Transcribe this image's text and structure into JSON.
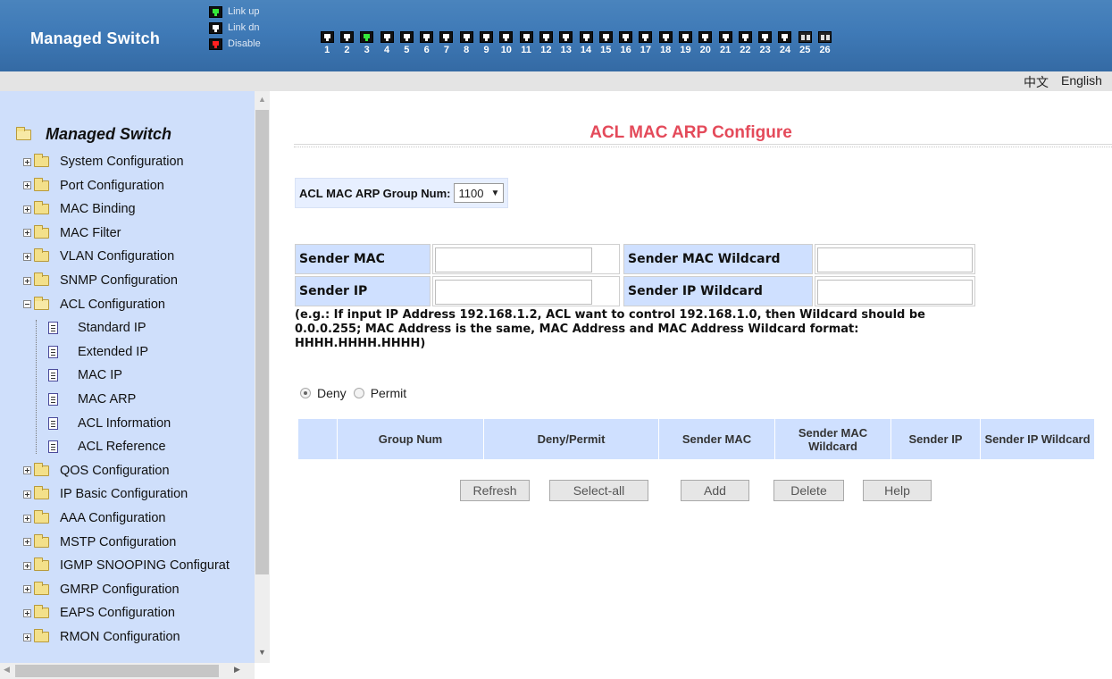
{
  "header": {
    "brand": "Managed Switch",
    "legend": [
      {
        "label": "Link up",
        "state": "green"
      },
      {
        "label": "Link dn",
        "state": "white"
      },
      {
        "label": "Disable",
        "state": "red"
      }
    ],
    "ports": [
      {
        "num": "1",
        "state": "down"
      },
      {
        "num": "2",
        "state": "down"
      },
      {
        "num": "3",
        "state": "up"
      },
      {
        "num": "4",
        "state": "down"
      },
      {
        "num": "5",
        "state": "down"
      },
      {
        "num": "6",
        "state": "down"
      },
      {
        "num": "7",
        "state": "down"
      },
      {
        "num": "8",
        "state": "down"
      },
      {
        "num": "9",
        "state": "down"
      },
      {
        "num": "10",
        "state": "down"
      },
      {
        "num": "11",
        "state": "down"
      },
      {
        "num": "12",
        "state": "down"
      },
      {
        "num": "13",
        "state": "down"
      },
      {
        "num": "14",
        "state": "down"
      },
      {
        "num": "15",
        "state": "down"
      },
      {
        "num": "16",
        "state": "down"
      },
      {
        "num": "17",
        "state": "down"
      },
      {
        "num": "18",
        "state": "down"
      },
      {
        "num": "19",
        "state": "down"
      },
      {
        "num": "20",
        "state": "down"
      },
      {
        "num": "21",
        "state": "down"
      },
      {
        "num": "22",
        "state": "down"
      },
      {
        "num": "23",
        "state": "down"
      },
      {
        "num": "24",
        "state": "down"
      },
      {
        "num": "25",
        "state": "fiber"
      },
      {
        "num": "26",
        "state": "fiber"
      }
    ]
  },
  "lang": {
    "chinese": "中文",
    "english": "English"
  },
  "sidebar": {
    "root": "Managed Switch",
    "items": [
      {
        "label": "System Configuration"
      },
      {
        "label": "Port Configuration"
      },
      {
        "label": "MAC Binding"
      },
      {
        "label": "MAC Filter"
      },
      {
        "label": "VLAN Configuration"
      },
      {
        "label": "SNMP Configuration"
      },
      {
        "label": "ACL Configuration"
      },
      {
        "label": "QOS Configuration"
      },
      {
        "label": "IP Basic Configuration"
      },
      {
        "label": "AAA Configuration"
      },
      {
        "label": "MSTP Configuration"
      },
      {
        "label": "IGMP SNOOPING Configurat"
      },
      {
        "label": "GMRP Configuration"
      },
      {
        "label": "EAPS Configuration"
      },
      {
        "label": "RMON Configuration"
      }
    ],
    "acl_children": [
      {
        "label": "Standard IP"
      },
      {
        "label": "Extended IP"
      },
      {
        "label": "MAC IP"
      },
      {
        "label": "MAC ARP"
      },
      {
        "label": "ACL Information"
      },
      {
        "label": "ACL Reference"
      }
    ]
  },
  "main": {
    "title": "ACL MAC ARP Configure",
    "group_label": "ACL MAC ARP Group Num:",
    "group_value": "1100",
    "fields": {
      "sender_mac": "Sender MAC",
      "sender_mac_wildcard": "Sender MAC Wildcard",
      "sender_ip": "Sender IP",
      "sender_ip_wildcard": "Sender IP Wildcard"
    },
    "example": "(e.g.: If input IP Address 192.168.1.2, ACL want to control 192.168.1.0, then Wildcard should be 0.0.0.255; MAC Address is the same, MAC Address and MAC Address Wildcard format: HHHH.HHHH.HHHH)",
    "radio": {
      "deny": "Deny",
      "permit": "Permit",
      "selected": "Deny"
    },
    "table_headers": [
      "",
      "Group Num",
      "Deny/Permit",
      "Sender MAC",
      "Sender MAC Wildcard",
      "Sender IP",
      "Sender IP Wildcard"
    ],
    "buttons": {
      "refresh": "Refresh",
      "select_all": "Select-all",
      "add": "Add",
      "delete": "Delete",
      "help": "Help"
    }
  },
  "colors": {
    "header_blue": "#3f7ab7",
    "sidebar_bg": "#cfdffb",
    "title_red": "#e44a5a",
    "label_bg": "#cfe0ff"
  }
}
